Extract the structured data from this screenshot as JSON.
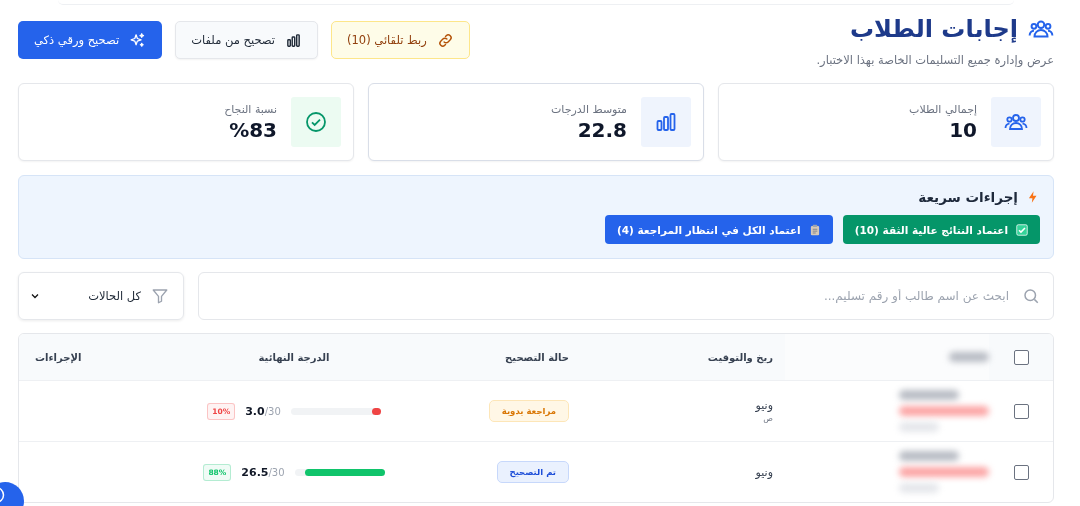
{
  "header": {
    "title": "إجابات الطلاب",
    "subtitle": "عرض وإدارة جميع التسليمات الخاصة بهذا الاختبار."
  },
  "header_buttons": [
    {
      "kind": "warning",
      "label": "ربط تلقائي (10)"
    },
    {
      "kind": "secondary",
      "label": "تصحيح من ملفات"
    },
    {
      "kind": "primary",
      "label": "تصحيح ورقي ذكي"
    }
  ],
  "stats": [
    {
      "kind": "students",
      "label": "إجمالي الطلاب",
      "value": "10"
    },
    {
      "kind": "average",
      "label": "متوسط الدرجات",
      "value": "22.8"
    },
    {
      "kind": "success",
      "label": "نسبة النجاح",
      "value": "%83"
    }
  ],
  "quick_actions": {
    "title": "إجراءات سريعة",
    "buttons": [
      {
        "kind": "success",
        "label": "اعتماد النتائج عالية الثقة (10)"
      },
      {
        "kind": "primary",
        "label": "اعتماد الكل في انتظار المراجعة (4)"
      }
    ]
  },
  "search": {
    "placeholder": "ابحث عن اسم طالب أو رقم تسليم..."
  },
  "filter": {
    "value": "كل الحالات"
  },
  "table": {
    "select_all": {
      "checked": false
    },
    "columns": [
      "ريخ والتوقيت",
      "حالة التصحيح",
      "الدرجة النهائية",
      "الإجراءات"
    ],
    "rows": [
      {
        "checked": false,
        "date": "ونيو",
        "time": "ص",
        "status": {
          "kind": "manual_review",
          "label": "مراجعة يدوية"
        },
        "score": "3.0",
        "max": "/30",
        "level": 0.1,
        "percent": "10%",
        "color": "#ef4444"
      },
      {
        "checked": false,
        "date": "ونيو",
        "status": {
          "kind": "graded",
          "label": "تم التصحيح"
        },
        "score": "26.5",
        "max": "/30",
        "level": 0.88,
        "percent": "88%",
        "color": "#10c46b"
      }
    ]
  }
}
